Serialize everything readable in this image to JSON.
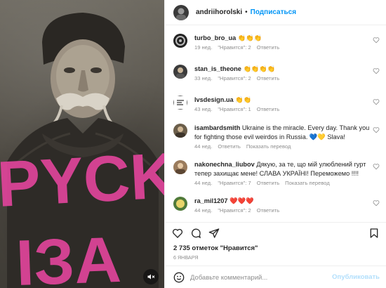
{
  "post": {
    "author": "andriihorolski",
    "separator": "•",
    "follow_label": "Подписаться",
    "likes_text": "2 735 отметок \"Нравится\"",
    "date_text": "6 января"
  },
  "media": {
    "graffiti_line1": "PYCK",
    "graffiti_line2": "ІЗА",
    "mute_icon": "speaker-muted-icon"
  },
  "comments": [
    {
      "user": "turbo_bro_ua",
      "text": "👏👏👏",
      "meta": {
        "age": "19 нед.",
        "likes": "\"Нравится\": 2",
        "reply": "Ответить",
        "translate": ""
      }
    },
    {
      "user": "stan_is_theone",
      "text": "👏👏👏👏",
      "meta": {
        "age": "33 нед.",
        "likes": "\"Нравится\": 2",
        "reply": "Ответить",
        "translate": ""
      }
    },
    {
      "user": "lvsdesign.ua",
      "text": "👏👏",
      "meta": {
        "age": "43 нед.",
        "likes": "\"Нравится\": 1",
        "reply": "Ответить",
        "translate": ""
      }
    },
    {
      "user": "isambardsmith",
      "text": "Ukraine is the miracle. Every day. Thank you for fighting those evil weirdos in Russia. 💙💛 Slava!",
      "meta": {
        "age": "44 нед.",
        "likes": "",
        "reply": "Ответить",
        "translate": "Показать перевод"
      }
    },
    {
      "user": "nakonechna_liubov",
      "text": "Дякую, за те, що мій улюблений гурт тепер захищає мене! СЛАВА УКРАЇНІ! Переможемо !!!!",
      "meta": {
        "age": "44 нед.",
        "likes": "\"Нравится\": 7",
        "reply": "Ответить",
        "translate": "Показать перевод"
      }
    },
    {
      "user": "ra_mil1207",
      "text": "❤️❤️❤️",
      "meta": {
        "age": "44 нед.",
        "likes": "\"Нравится\": 2",
        "reply": "Ответить",
        "translate": ""
      }
    }
  ],
  "composer": {
    "placeholder": "Добавьте комментарий...",
    "post_label": "Опубликовать"
  },
  "colors": {
    "accent": "#0095f6",
    "graffiti": "#e0449b"
  }
}
